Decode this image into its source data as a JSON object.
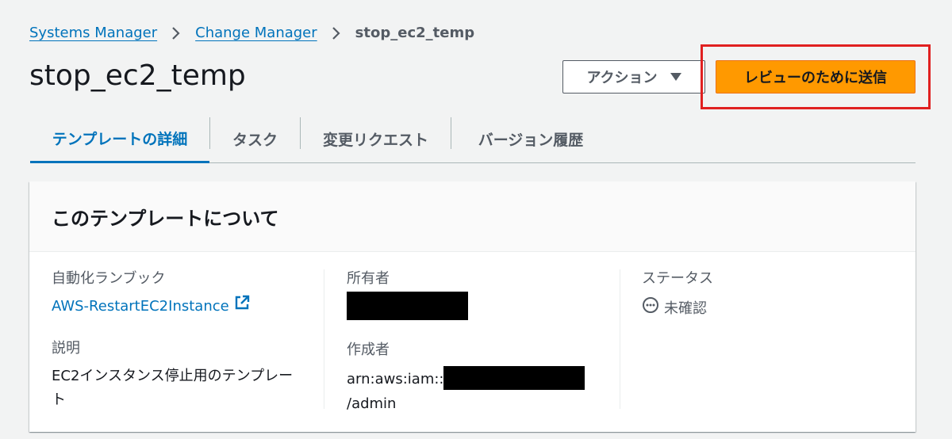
{
  "breadcrumb": {
    "items": [
      "Systems Manager",
      "Change Manager"
    ],
    "current": "stop_ec2_temp"
  },
  "page": {
    "title": "stop_ec2_temp"
  },
  "header_actions": {
    "actions_label": "アクション",
    "submit_label": "レビューのために送信"
  },
  "tabs": [
    "テンプレートの詳細",
    "タスク",
    "変更リクエスト",
    "バージョン履歴"
  ],
  "card": {
    "title": "このテンプレートについて",
    "runbook_label": "自動化ランブック",
    "runbook_value": "AWS-RestartEC2Instance",
    "description_label": "説明",
    "description_value": "EC2インスタンス停止用のテンプレート",
    "owner_label": "所有者",
    "creator_label": "作成者",
    "creator_prefix": "arn:aws:iam::",
    "creator_suffix": "/admin",
    "status_label": "ステータス",
    "status_value": "未確認"
  },
  "colors": {
    "accent": "#0073bb",
    "primary_button": "#ff9900",
    "highlight": "#e02020"
  },
  "icons": [
    "chevron-right-icon",
    "caret-down-icon",
    "external-link-icon",
    "status-pending-icon"
  ]
}
